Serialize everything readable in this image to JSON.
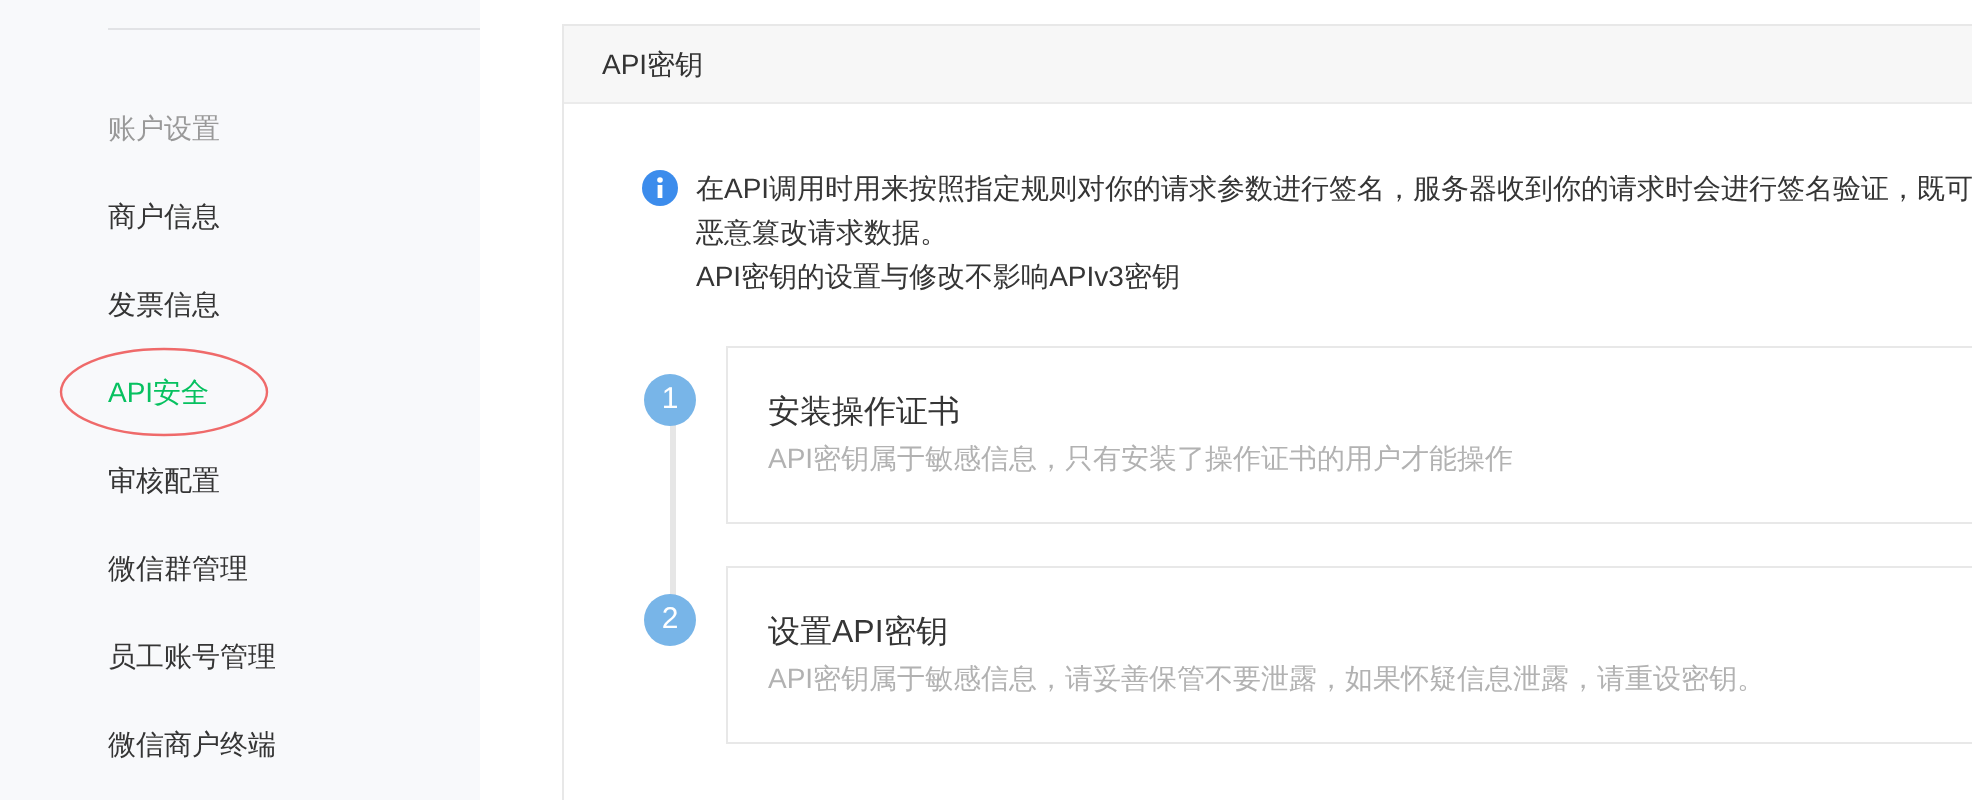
{
  "sidebar": {
    "group_title": "账户设置",
    "items": [
      {
        "label": "商户信息",
        "selected": false,
        "circled": false
      },
      {
        "label": "发票信息",
        "selected": false,
        "circled": false
      },
      {
        "label": "API安全",
        "selected": true,
        "circled": true
      },
      {
        "label": "审核配置",
        "selected": false,
        "circled": false
      },
      {
        "label": "微信群管理",
        "selected": false,
        "circled": false
      },
      {
        "label": "员工账号管理",
        "selected": false,
        "circled": false
      },
      {
        "label": "微信商户终端",
        "selected": false,
        "circled": false
      }
    ]
  },
  "panel": {
    "title": "API密钥",
    "notice_lines": [
      "在API调用时用来按照指定规则对你的请求参数进行签名，服务器收到你的请求时会进行签名验证，既可",
      "恶意篡改请求数据。",
      "API密钥的设置与修改不影响APIv3密钥"
    ],
    "steps": [
      {
        "number": "1",
        "title": "安装操作证书",
        "description": "API密钥属于敏感信息，只有安装了操作证书的用户才能操作"
      },
      {
        "number": "2",
        "title": "设置API密钥",
        "description": "API密钥属于敏感信息，请妥善保管不要泄露，如果怀疑信息泄露，请重设密钥。"
      }
    ]
  }
}
